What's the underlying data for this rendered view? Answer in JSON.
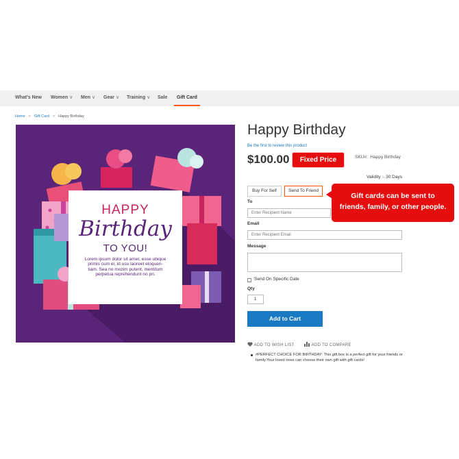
{
  "nav": {
    "items": [
      {
        "label": "What's New",
        "chevron": ""
      },
      {
        "label": "Women",
        "chevron": "∨"
      },
      {
        "label": "Men",
        "chevron": "∨"
      },
      {
        "label": "Gear",
        "chevron": "∨"
      },
      {
        "label": "Training",
        "chevron": "∨"
      },
      {
        "label": "Sale",
        "chevron": ""
      },
      {
        "label": "Gift Card",
        "chevron": ""
      }
    ],
    "active_item": "Gift Card",
    "active_color": "#ff5501"
  },
  "breadcrumb": {
    "items": [
      "Home",
      "Gift Card",
      "Happy Birthday"
    ],
    "separator": ">"
  },
  "hero": {
    "card_line1": "HAPPY",
    "card_line2": "Birthday",
    "card_line3": "TO YOU!",
    "lorem": [
      "Lorem ipsum dolor sit amet, esse ubique",
      "primis cum ei, id usu laoreet eloquen-",
      "tiam. Sea no mozim putent, mentitum",
      "perpetua reprehendunt no pri."
    ],
    "background": "#5a2478",
    "icon": "gift-boxes-illustration"
  },
  "product": {
    "title": "Happy Birthday",
    "review_link": "Be the first to review this product",
    "price": "$100.00",
    "fixed_price_badge": "Fixed Price",
    "sku_label": "SKU#:",
    "sku_value": "Happy Birthday",
    "validity": "Validity :- 30 Days"
  },
  "tabs": {
    "buy_for_self": "Buy For Self",
    "send_to_friend": "Send To Friend",
    "active": "Send To Friend"
  },
  "callout": {
    "line1": "Gift cards can be sent to",
    "line2": "friends, family, or other people.",
    "color": "#e50d0d"
  },
  "form": {
    "to_label": "To",
    "to_placeholder": "Enter Recipient Name",
    "email_label": "Email",
    "email_placeholder": "Enter Recipient Email",
    "message_label": "Message",
    "specific_date_label": "Send On Specific Date",
    "qty_label": "Qty",
    "qty_value": "1",
    "add_to_cart": "Add to Cart"
  },
  "actions": {
    "wish_list": "ADD TO WISH LIST",
    "wish_icon": "heart-icon",
    "compare": "ADD TO COMPARE",
    "compare_icon": "bar-chart-icon"
  },
  "description": {
    "bullet": "#PERFECT CHOICE FOR BIRTHDAY: This gift box is a perfect gift for your friends or family.Your loved ones can choose their own gift with gift cards!"
  },
  "colors": {
    "link": "#1979c3",
    "button": "#1979c3",
    "badge": "#e50d0d"
  }
}
